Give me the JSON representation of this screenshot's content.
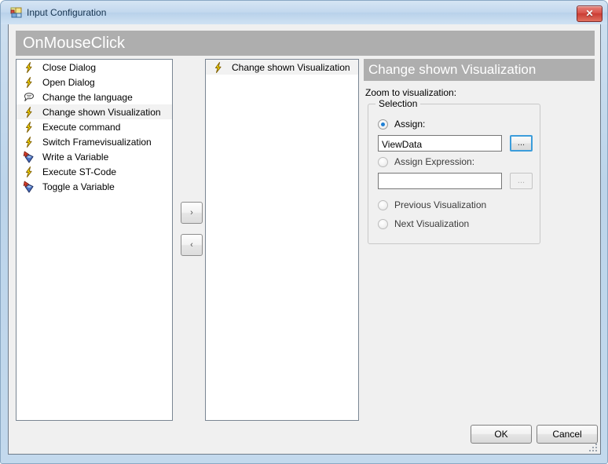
{
  "window": {
    "title": "Input Configuration",
    "icon": "form-icon",
    "close_label": "✕"
  },
  "event_header": {
    "title": "OnMouseClick"
  },
  "available_list": {
    "name": "available-actions-list",
    "items": [
      {
        "label": "Close Dialog",
        "icon": "lightning-icon",
        "selected": false
      },
      {
        "label": "Open Dialog",
        "icon": "lightning-icon",
        "selected": false
      },
      {
        "label": "Change the language",
        "icon": "language-icon",
        "selected": false
      },
      {
        "label": "Change shown Visualization",
        "icon": "lightning-icon",
        "selected": true
      },
      {
        "label": "Execute command",
        "icon": "lightning-icon",
        "selected": false
      },
      {
        "label": "Switch Framevisualization",
        "icon": "lightning-icon",
        "selected": false
      },
      {
        "label": "Write a Variable",
        "icon": "variable-icon",
        "selected": false
      },
      {
        "label": "Execute ST-Code",
        "icon": "lightning-icon",
        "selected": false
      },
      {
        "label": "Toggle a Variable",
        "icon": "variable-icon",
        "selected": false
      }
    ]
  },
  "assigned_list": {
    "name": "assigned-actions-list",
    "items": [
      {
        "label": "Change shown Visualization",
        "icon": "lightning-icon",
        "selected": true
      }
    ]
  },
  "transfer": {
    "add_label": "›",
    "remove_label": "‹"
  },
  "details": {
    "header": "Change shown Visualization",
    "zoom_label": "Zoom to visualization:",
    "groupbox_label": "Selection",
    "options": [
      {
        "label": "Assign:",
        "checked": true,
        "enabled": true
      },
      {
        "label": "Assign Expression:",
        "checked": false,
        "enabled": false
      },
      {
        "label": "Previous Visualization",
        "checked": false,
        "enabled": false
      },
      {
        "label": "Next Visualization",
        "checked": false,
        "enabled": false
      }
    ],
    "assign_value": "ViewData",
    "assign_placeholder": "",
    "assign_browse_label": "...",
    "expression_value": "",
    "expression_placeholder": "",
    "expression_browse_label": "..."
  },
  "footer": {
    "ok_label": "OK",
    "cancel_label": "Cancel"
  },
  "colors": {
    "header_band": "#aeaeae",
    "window_frame": "#c3d9ed",
    "client_bg": "#f0f0f0",
    "radio_accent": "#1e7fd4",
    "focus_border": "#3c9ddb",
    "selection_bg": "#f2f2f2"
  }
}
